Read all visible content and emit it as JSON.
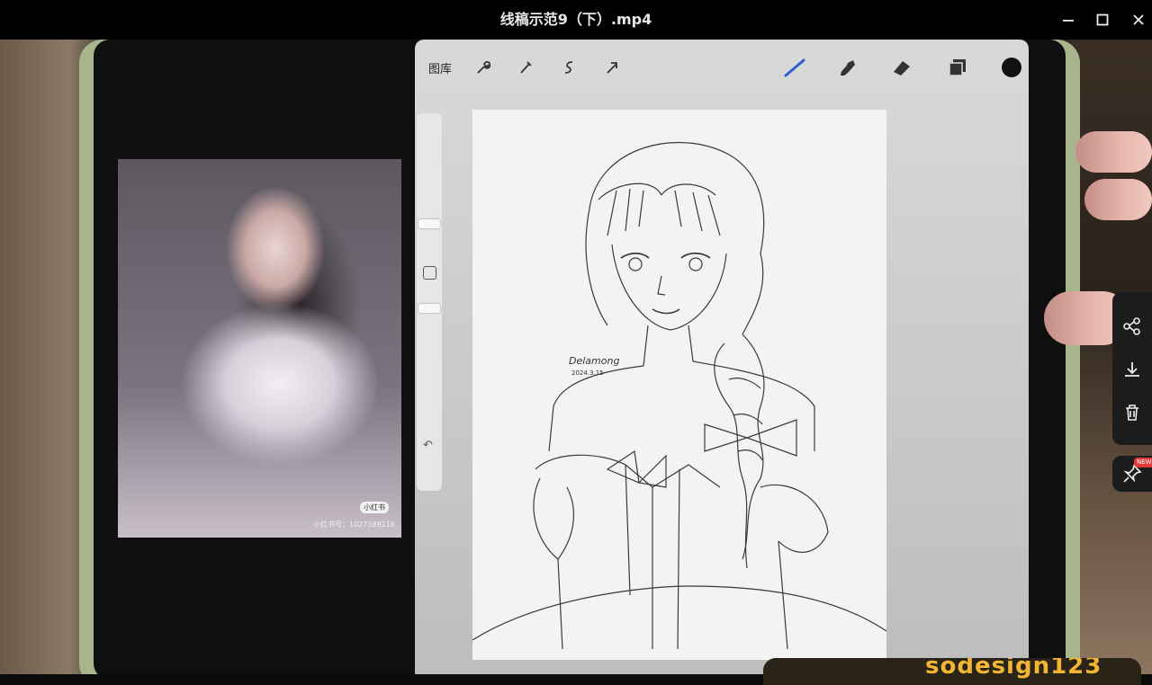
{
  "window": {
    "title": "线稿示范9（下）.mp4",
    "controls": [
      "minimize",
      "maximize",
      "close"
    ]
  },
  "procreate": {
    "toolbar": {
      "gallery_label": "图库",
      "icons": [
        "wrench-icon",
        "adjust-wand-icon",
        "selection-s-icon",
        "transform-arrow-icon",
        "brush-icon",
        "smudge-icon",
        "eraser-icon",
        "layers-icon",
        "color-swatch-icon"
      ]
    }
  },
  "reference_photo": {
    "badge": "小红书",
    "caption": "小红书号：1027589116"
  },
  "drawing": {
    "signature": "Delamong",
    "date": "2024.3.15"
  },
  "side_panel": {
    "icons": [
      "share-icon",
      "download-icon",
      "trash-icon",
      "pin-icon"
    ],
    "new_badge": "NEW"
  },
  "banner": {
    "text": "sodesign123"
  },
  "colors": {
    "title_bar": "#000000",
    "tablet_case": "#a8b48c",
    "brush_active": "#2f5fd1",
    "banner_text": "#f2b632"
  }
}
